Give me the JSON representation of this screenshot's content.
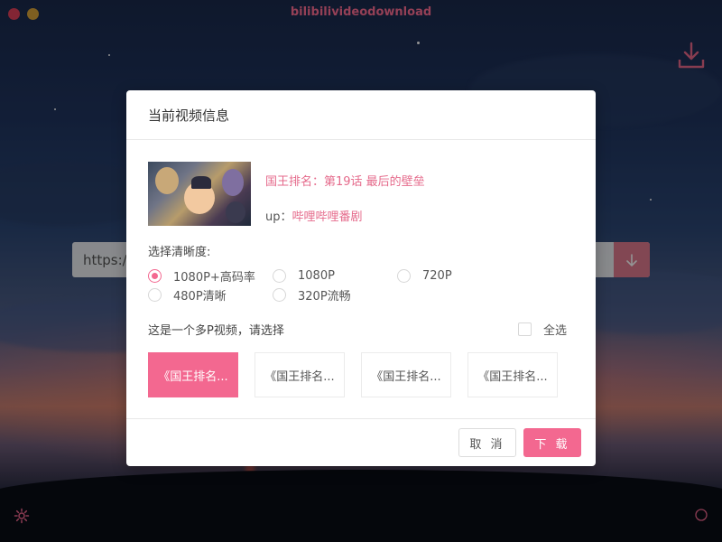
{
  "app": {
    "title": "bilibilivideodownload",
    "colors": {
      "accent": "#f36890",
      "title": "#ff6e94",
      "close": "#e0405a",
      "minimize": "#d9a43a"
    }
  },
  "url_bar": {
    "value": "https://",
    "go_icon": "arrow-down-icon"
  },
  "modal": {
    "title": "当前视频信息",
    "video": {
      "title": "国王排名：第19话 最后的壁垒",
      "up_label": "up：",
      "up_name": "哔哩哔哩番剧"
    },
    "quality": {
      "label": "选择清晰度:",
      "selected": "1080P+高码率",
      "options": [
        "1080P+高码率",
        "1080P",
        "720P",
        "480P清晰",
        "320P流畅"
      ]
    },
    "multi_part": {
      "label": "这是一个多P视频，请选择",
      "select_all": "全选"
    },
    "episodes": [
      "《国王排名...",
      "《国王排名...",
      "《国王排名...",
      "《国王排名..."
    ],
    "buttons": {
      "cancel": "取 消",
      "download": "下 载"
    }
  }
}
